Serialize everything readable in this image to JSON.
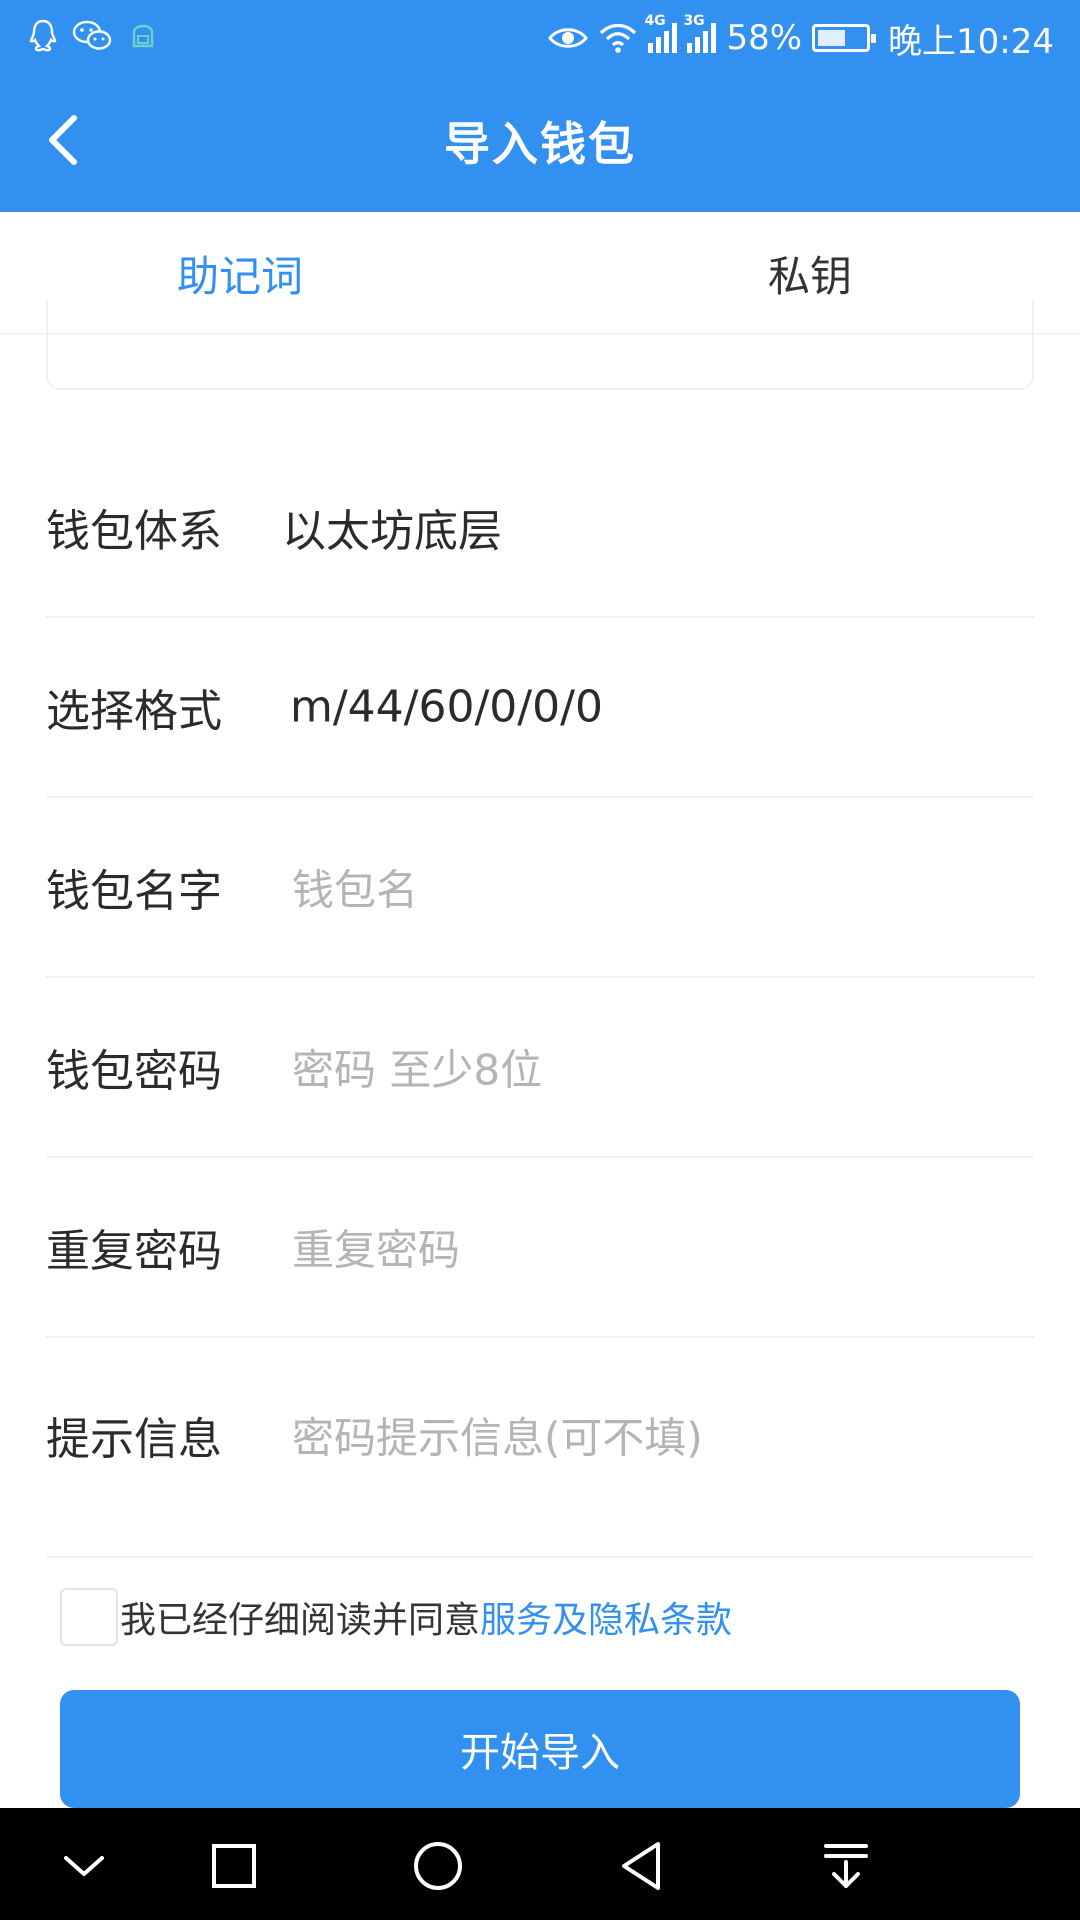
{
  "status_bar": {
    "time": "晚上10:24",
    "battery": "58%",
    "battery_level": 0.58,
    "signal_1_type": "4G",
    "signal_2_type": "3G",
    "left_icons": [
      "qq-icon",
      "wechat-icon",
      "app-notification-icon"
    ],
    "right_icons": [
      "eye-icon",
      "wifi-icon",
      "signal-icon",
      "signal-icon",
      "battery-icon"
    ]
  },
  "header": {
    "title": "导入钱包",
    "back_icon": "chevron-left-icon"
  },
  "tabs": [
    {
      "label": "助记词",
      "active": true
    },
    {
      "label": "私钥",
      "active": false
    }
  ],
  "form": {
    "wallet_system": {
      "label": "钱包体系",
      "value": "以太坊底层"
    },
    "format": {
      "label": "选择格式",
      "value": "m/44/60/0/0/0"
    },
    "wallet_name": {
      "label": "钱包名字",
      "placeholder": "钱包名"
    },
    "wallet_password": {
      "label": "钱包密码",
      "placeholder": "密码 至少8位"
    },
    "repeat_password": {
      "label": "重复密码",
      "placeholder": "重复密码"
    },
    "hint": {
      "label": "提示信息",
      "placeholder": "密码提示信息(可不填)"
    }
  },
  "agreement": {
    "checked": false,
    "text": "我已经仔细阅读并同意",
    "link": "服务及隐私条款"
  },
  "submit_label": "开始导入",
  "colors": {
    "primary": "#3291f0",
    "text": "#2b2b2b",
    "placeholder": "#b4b4b4",
    "nav_bar": "#000000"
  },
  "nav_bar": {
    "icons": [
      "chevron-down-icon",
      "square-icon",
      "circle-icon",
      "triangle-back-icon",
      "notification-pull-icon"
    ]
  }
}
